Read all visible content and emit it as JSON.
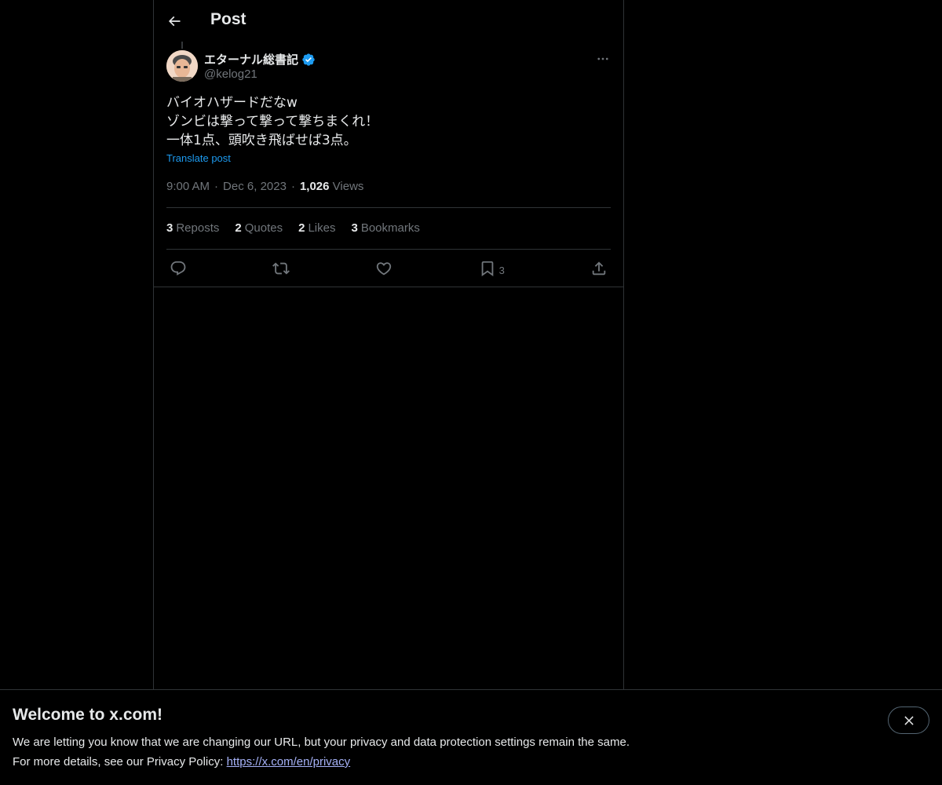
{
  "header": {
    "title": "Post",
    "back_icon": "arrow-left-icon"
  },
  "post": {
    "author": {
      "name": "エターナル総書記",
      "handle": "@kelog21",
      "verified": true
    },
    "text_lines": [
      "バイオハザードだなw",
      "ゾンビは撃って撃って撃ちまくれ！",
      "一体1点、頭吹き飛ばせば3点。"
    ],
    "translate_label": "Translate post",
    "time": "9:00 AM",
    "date": "Dec 6, 2023",
    "views_count": "1,026",
    "views_label": "Views",
    "separator": "·",
    "stats": {
      "reposts": {
        "count": "3",
        "label": "Reposts"
      },
      "quotes": {
        "count": "2",
        "label": "Quotes"
      },
      "likes": {
        "count": "2",
        "label": "Likes"
      },
      "bookmarks": {
        "count": "3",
        "label": "Bookmarks"
      }
    },
    "actions": {
      "reply_icon": "reply-icon",
      "repost_icon": "repost-icon",
      "like_icon": "heart-icon",
      "bookmark_icon": "bookmark-icon",
      "bookmark_count": "3",
      "share_icon": "share-icon"
    }
  },
  "banner": {
    "title": "Welcome to x.com!",
    "line1": "We are letting you know that we are changing our URL, but your privacy and data protection settings remain the same.",
    "line2_prefix": "For more details, see our Privacy Policy: ",
    "link": "https://x.com/en/privacy"
  },
  "colors": {
    "background": "#000000",
    "text": "#e7e9ea",
    "muted": "#71767b",
    "accent": "#1d9bf0",
    "border": "#2f3336",
    "link_banner": "#a6b2f8"
  }
}
